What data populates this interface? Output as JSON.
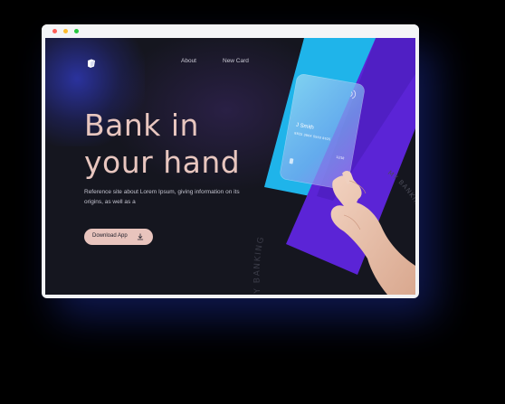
{
  "browser": {
    "controls": [
      "close",
      "minimize",
      "maximize"
    ]
  },
  "nav": {
    "logo_icon": "book-icon",
    "links": [
      {
        "label": "About"
      },
      {
        "label": "New Card"
      }
    ]
  },
  "hero": {
    "title": "Bank in your hand",
    "description": "Reference site about Lorem Ipsum, giving information on its origins, as well as a",
    "button_label": "Download App",
    "button_icon": "download-icon"
  },
  "card": {
    "holder": "J Smith",
    "number": "8825 3864 5563 8625",
    "expiry": "12/18"
  },
  "decor": {
    "curved_text": "MY BANKING"
  },
  "colors": {
    "background": "#15161f",
    "accent_peach": "#e8c6bf",
    "cyan_panel": "#1fb4ea",
    "purple_panel": "#5b24d6"
  }
}
